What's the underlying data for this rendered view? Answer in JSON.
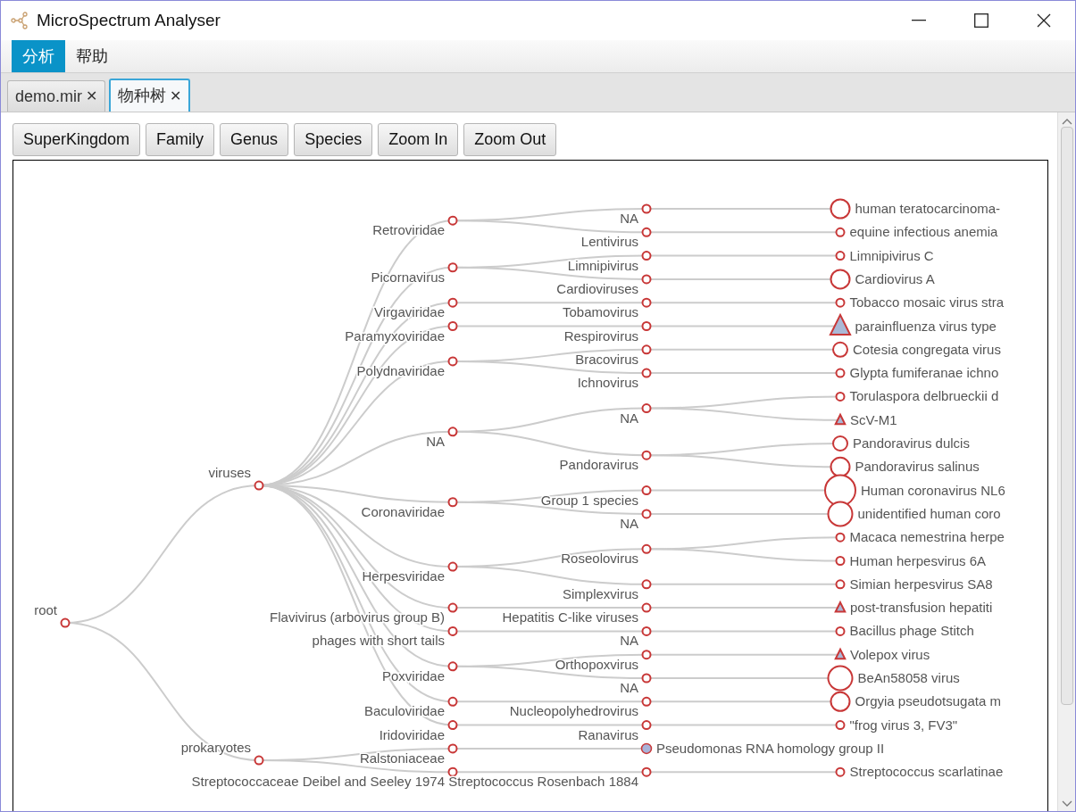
{
  "window": {
    "title": "MicroSpectrum Analyser"
  },
  "menu": [
    {
      "label": "分析",
      "selected": true
    },
    {
      "label": "帮助",
      "selected": false
    }
  ],
  "tabs": [
    {
      "label": "demo.mir",
      "close": "✕",
      "selected": false
    },
    {
      "label": "物种树",
      "close": "✕",
      "selected": true
    }
  ],
  "toolbar": [
    "SuperKingdom",
    "Family",
    "Genus",
    "Species",
    "Zoom In",
    "Zoom Out"
  ],
  "tree": {
    "label": "root",
    "children": [
      {
        "label": "viruses",
        "children": [
          {
            "label": "Retroviridae",
            "children": [
              {
                "label": "NA",
                "children": [
                  {
                    "label": "human teratocarcinoma-",
                    "kind": "bigring"
                  }
                ]
              },
              {
                "label": "Lentivirus",
                "children": [
                  {
                    "label": "equine infectious anemia",
                    "kind": "ring"
                  }
                ]
              }
            ]
          },
          {
            "label": "Picornavirus",
            "children": [
              {
                "label": "Limnipivirus",
                "children": [
                  {
                    "label": "Limnipivirus C",
                    "kind": "ring"
                  }
                ]
              },
              {
                "label": "Cardioviruses",
                "children": [
                  {
                    "label": "Cardiovirus A",
                    "kind": "bigring"
                  }
                ]
              }
            ]
          },
          {
            "label": "Virgaviridae",
            "children": [
              {
                "label": "Tobamovirus",
                "children": [
                  {
                    "label": "Tobacco mosaic virus stra",
                    "kind": "ring"
                  }
                ]
              }
            ]
          },
          {
            "label": "Paramyxoviridae",
            "children": [
              {
                "label": "Respirovirus",
                "children": [
                  {
                    "label": "parainfluenza virus type",
                    "kind": "bigtriangle"
                  }
                ]
              }
            ]
          },
          {
            "label": "Polydnaviridae",
            "children": [
              {
                "label": "Bracovirus",
                "children": [
                  {
                    "label": "Cotesia congregata virus",
                    "kind": "midring"
                  }
                ]
              },
              {
                "label": "Ichnovirus",
                "children": [
                  {
                    "label": "Glypta fumiferanae ichno",
                    "kind": "ring"
                  }
                ]
              }
            ]
          },
          {
            "label": "NA",
            "children": [
              {
                "label": "NA",
                "children": [
                  {
                    "label": "Torulaspora delbrueckii d",
                    "kind": "ring"
                  },
                  {
                    "label": "ScV-M1",
                    "kind": "triangle"
                  }
                ]
              },
              {
                "label": "Pandoravirus",
                "children": [
                  {
                    "label": "Pandoravirus dulcis",
                    "kind": "midring"
                  },
                  {
                    "label": "Pandoravirus salinus",
                    "kind": "bigring"
                  }
                ]
              }
            ]
          },
          {
            "label": "Coronaviridae",
            "children": [
              {
                "label": "Group 1 species",
                "children": [
                  {
                    "label": "Human coronavirus NL6",
                    "kind": "hugering"
                  }
                ]
              },
              {
                "label": "NA",
                "children": [
                  {
                    "label": "unidentified human coro",
                    "kind": "widering"
                  }
                ]
              }
            ]
          },
          {
            "label": "Herpesviridae",
            "children": [
              {
                "label": "Roseolovirus",
                "children": [
                  {
                    "label": "Macaca nemestrina herpe",
                    "kind": "ring"
                  },
                  {
                    "label": "Human herpesvirus 6A",
                    "kind": "ring"
                  }
                ]
              },
              {
                "label": "Simplexvirus",
                "children": [
                  {
                    "label": "Simian herpesvirus SA8",
                    "kind": "ring"
                  }
                ]
              }
            ]
          },
          {
            "label": "Flavivirus (arbovirus group B)",
            "children": [
              {
                "label": "Hepatitis C-like viruses",
                "children": [
                  {
                    "label": "post-transfusion hepatiti",
                    "kind": "triangle"
                  }
                ]
              }
            ]
          },
          {
            "label": "phages with short tails",
            "children": [
              {
                "label": "NA",
                "children": [
                  {
                    "label": "Bacillus phage Stitch",
                    "kind": "ring"
                  }
                ]
              }
            ]
          },
          {
            "label": "Poxviridae",
            "children": [
              {
                "label": "Orthopoxvirus",
                "children": [
                  {
                    "label": "Volepox virus",
                    "kind": "triangle"
                  }
                ]
              },
              {
                "label": "NA",
                "children": [
                  {
                    "label": "BeAn58058 virus",
                    "kind": "widering"
                  }
                ]
              }
            ]
          },
          {
            "label": "Baculoviridae",
            "children": [
              {
                "label": "Nucleopolyhedrovirus",
                "children": [
                  {
                    "label": "Orgyia pseudotsugata m",
                    "kind": "bigring"
                  }
                ]
              }
            ]
          },
          {
            "label": "Iridoviridae",
            "children": [
              {
                "label": "Ranavirus",
                "children": [
                  {
                    "label": "\"frog virus 3, FV3\"",
                    "kind": "ring"
                  }
                ]
              }
            ]
          }
        ]
      },
      {
        "label": "prokaryotes",
        "children": [
          {
            "label": "Ralstoniaceae",
            "children": [
              {
                "label": "Pseudomonas RNA homology group II",
                "kind": "dot"
              }
            ]
          },
          {
            "label": "Streptococcaceae Deibel and Seeley 1974",
            "children": [
              {
                "label": "Streptococcus Rosenbach 1884",
                "children": [
                  {
                    "label": "Streptococcus scarlatinae",
                    "kind": "ring"
                  }
                ]
              }
            ]
          }
        ]
      }
    ]
  }
}
